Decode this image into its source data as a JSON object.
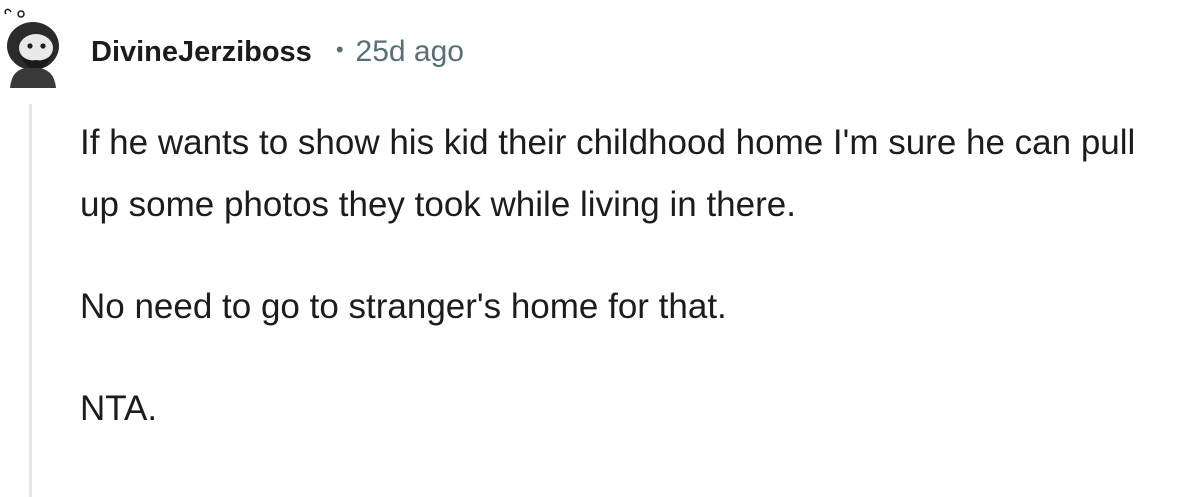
{
  "comment": {
    "author": "DivineJerziboss",
    "separator": "•",
    "timestamp": "25d ago",
    "avatar_icon": "snoo-avatar-bearded",
    "paragraphs": [
      "If he wants to show his kid their childhood home I'm sure he can pull up some photos they took while living in there.",
      "No need to go to stranger's home for that.",
      "NTA."
    ]
  },
  "colors": {
    "text": "#1c1c1c",
    "meta": "#576f76",
    "thread_line": "#e4e6e7"
  }
}
